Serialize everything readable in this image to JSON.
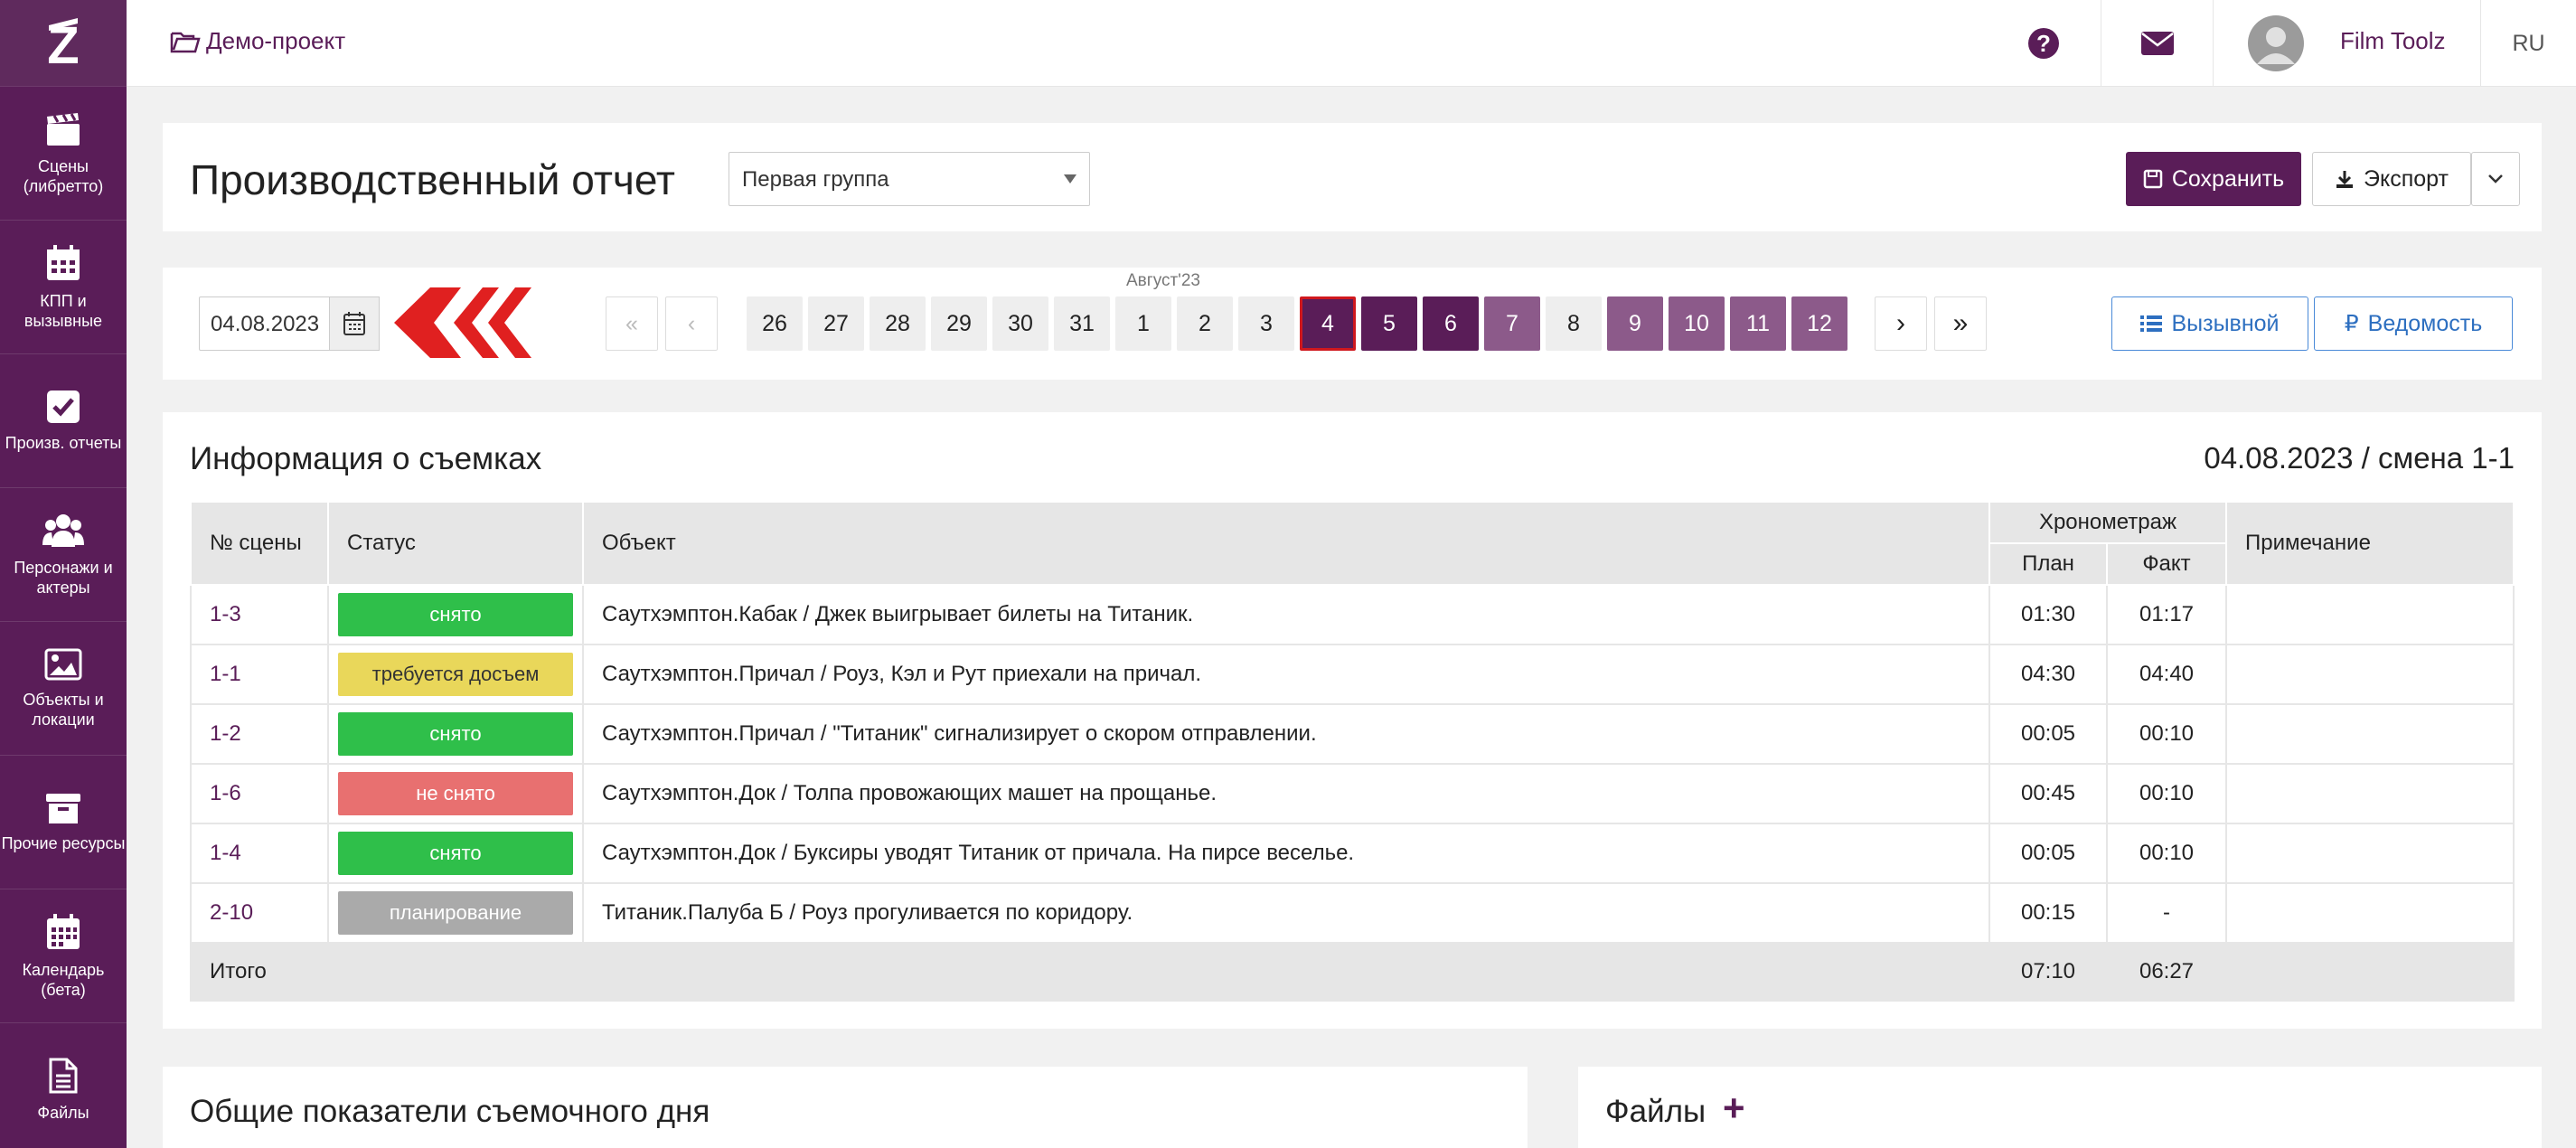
{
  "sidebar": {
    "logo": "Z",
    "items": [
      {
        "label": "Сцены (либретто)",
        "icon": "clapperboard-icon"
      },
      {
        "label": "КПП и вызывные",
        "icon": "calendar-icon"
      },
      {
        "label": "Произв. отчеты",
        "icon": "checkbox-icon"
      },
      {
        "label": "Персонажи и актеры",
        "icon": "users-icon"
      },
      {
        "label": "Объекты и локации",
        "icon": "image-icon"
      },
      {
        "label": "Прочие ресурсы",
        "icon": "archive-icon"
      },
      {
        "label": "Календарь (бета)",
        "icon": "calendar-grid-icon"
      },
      {
        "label": "Файлы",
        "icon": "file-icon"
      }
    ]
  },
  "topbar": {
    "project": "Демо-проект",
    "user": "Film Toolz",
    "lang": "RU"
  },
  "header": {
    "title": "Производственный отчет",
    "group": "Первая группа",
    "save": "Сохранить",
    "export": "Экспорт"
  },
  "dates": {
    "current": "04.08.2023",
    "month": "Август'23",
    "days": [
      "26",
      "27",
      "28",
      "29",
      "30",
      "31",
      "1",
      "2",
      "3",
      "4",
      "5",
      "6",
      "7",
      "8",
      "9",
      "10",
      "11",
      "12"
    ],
    "callsheet": "Вызывной",
    "statement": "Ведомость"
  },
  "info": {
    "title": "Информация о съемках",
    "date_shift": "04.08.2023 / смена 1-1",
    "columns": {
      "scene": "№ сцены",
      "status": "Статус",
      "object": "Объект",
      "timing": "Хронометраж",
      "plan": "План",
      "fact": "Факт",
      "note": "Примечание"
    },
    "rows": [
      {
        "scene": "1-3",
        "status": "снято",
        "status_color": "#2fbf4a",
        "object": "Саутхэмптон.Кабак / Джек выигрывает билеты на Титаник.",
        "plan": "01:30",
        "fact": "01:17",
        "note": ""
      },
      {
        "scene": "1-1",
        "status": "требуется досъем",
        "status_color": "#e9d75a",
        "object": "Саутхэмптон.Причал / Роуз, Кэл и Рут приехали на причал.",
        "plan": "04:30",
        "fact": "04:40",
        "note": ""
      },
      {
        "scene": "1-2",
        "status": "снято",
        "status_color": "#2fbf4a",
        "object": "Саутхэмптон.Причал / \"Титаник\" сигнализирует о скором отправлении.",
        "plan": "00:05",
        "fact": "00:10",
        "note": ""
      },
      {
        "scene": "1-6",
        "status": "не снято",
        "status_color": "#e87070",
        "object": "Саутхэмптон.Док / Толпа провожающих машет на прощанье.",
        "plan": "00:45",
        "fact": "00:10",
        "note": ""
      },
      {
        "scene": "1-4",
        "status": "снято",
        "status_color": "#2fbf4a",
        "object": "Саутхэмптон.Док / Буксиры уводят Титаник от причала. На пирсе веселье.",
        "plan": "00:05",
        "fact": "00:10",
        "note": ""
      },
      {
        "scene": "2-10",
        "status": "планирование",
        "status_color": "#aaaaaa",
        "object": "Титаник.Палуба Б / Роуз прогуливается по коридору.",
        "plan": "00:15",
        "fact": "-",
        "note": ""
      }
    ],
    "total": {
      "label": "Итого",
      "plan": "07:10",
      "fact": "06:27"
    }
  },
  "bottom": {
    "stats_title": "Общие показатели съемочного дня",
    "files_title": "Файлы",
    "files_add": "+"
  }
}
